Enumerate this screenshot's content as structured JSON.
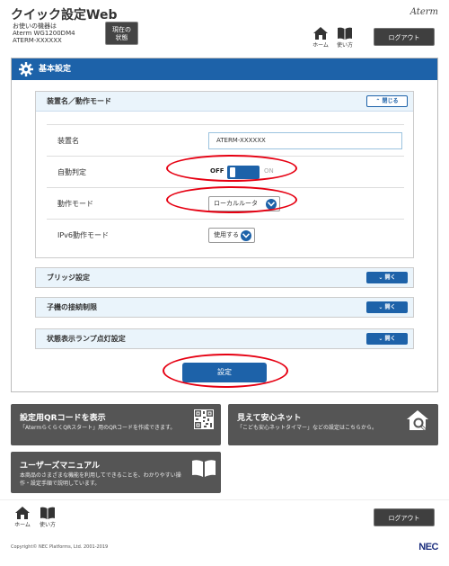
{
  "header": {
    "title": "クイック設定Web",
    "device_label": "お使いの機器は",
    "device_model": "Aterm WG1200DM4",
    "device_name": "ATERM-XXXXXX",
    "status_button": [
      "現在の",
      "状態"
    ],
    "brand": "Aterm",
    "home_label": "ホーム",
    "manual_label": "使い方",
    "logout_label": "ログアウト"
  },
  "section": {
    "title": "基本設定"
  },
  "panels": {
    "device_mode": {
      "title": "装置名／動作モード",
      "toggle_label": "閉じる",
      "rows": [
        {
          "label": "装置名",
          "value": "ATERM-XXXXXX"
        },
        {
          "label": "自動判定",
          "off": "OFF",
          "on": "ON"
        },
        {
          "label": "動作モード",
          "value": "ローカルルータ"
        },
        {
          "label": "IPv6動作モード",
          "value": "使用する"
        }
      ]
    },
    "bridge": {
      "title": "ブリッジ設定",
      "toggle_label": "開く"
    },
    "child_limit": {
      "title": "子機の接続制限",
      "toggle_label": "開く"
    },
    "lamp": {
      "title": "状態表示ランプ点灯設定",
      "toggle_label": "開く"
    }
  },
  "set_button": "設定",
  "tiles": {
    "qr": {
      "title": "設定用QRコードを表示",
      "desc": "「AtermらくらくQRスタート」用のQRコードを作成できます。"
    },
    "safety": {
      "title": "見えて安心ネット",
      "desc": "「こども安心ネットタイマー」などの設定はこちらから。"
    },
    "manual": {
      "title": "ユーザーズマニュアル",
      "desc_line1": "本商品のさまざまな機能を利用してできることを、わかりやすい操",
      "desc_line2": "作・設定手順で説明しています。"
    }
  },
  "footer": {
    "home_label": "ホーム",
    "manual_label": "使い方",
    "logout_label": "ログアウト",
    "copyright": "Copyright© NEC Platforms, Ltd. 2001-2019",
    "logo": "NEC"
  },
  "colors": {
    "accent": "#1d62a9",
    "header_dark": "#3f3f3f",
    "tile": "#555555",
    "highlight": "#e60012"
  }
}
